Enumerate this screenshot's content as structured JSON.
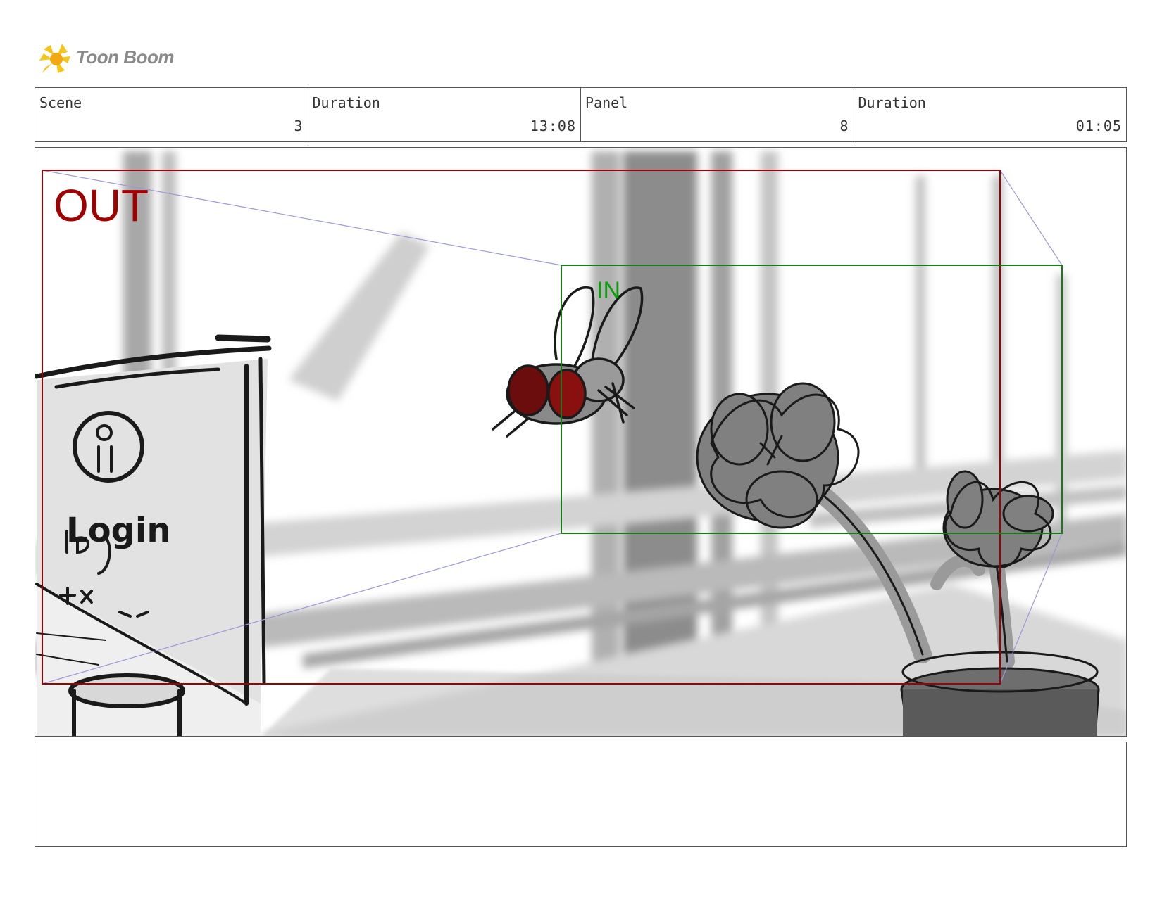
{
  "brand": {
    "name": "Toon Boom",
    "accent": "#f5c518"
  },
  "header": {
    "cells": [
      {
        "label": "Scene",
        "value": "3"
      },
      {
        "label": "Duration",
        "value": "13:08"
      },
      {
        "label": "Panel",
        "value": "8"
      },
      {
        "label": "Duration",
        "value": "01:05"
      }
    ]
  },
  "panel": {
    "camera_out_label": "OUT",
    "camera_in_label": "IN",
    "out_color": "#a00000",
    "in_color": "#0aa00a",
    "sketch_text": {
      "login": "Login"
    }
  },
  "notes": {
    "text": ""
  }
}
